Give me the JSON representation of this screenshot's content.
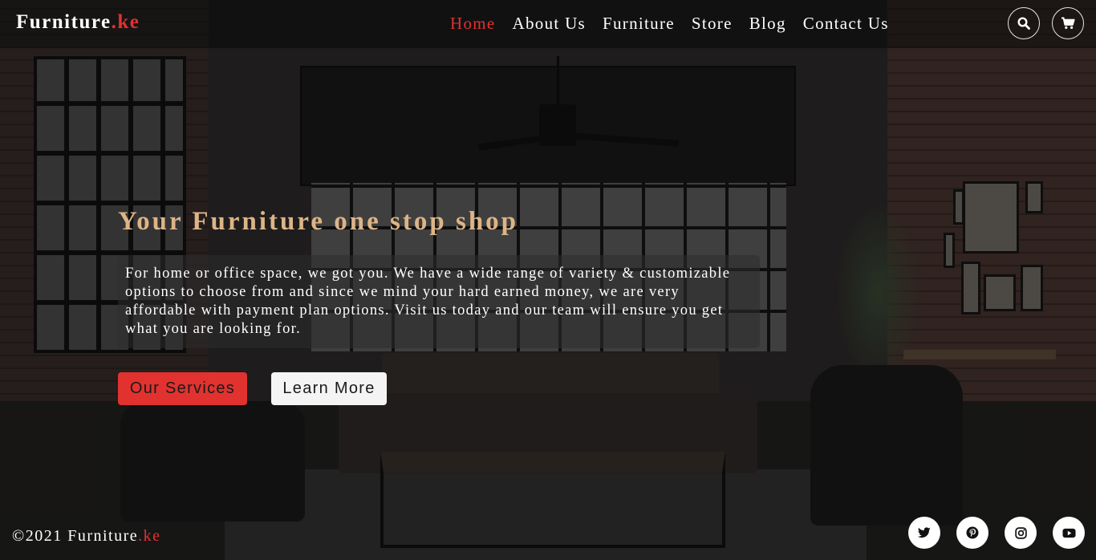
{
  "header": {
    "logo": {
      "main": "Furniture",
      "accent": ".ke"
    },
    "nav": [
      {
        "label": "Home",
        "active": true
      },
      {
        "label": "About Us",
        "active": false
      },
      {
        "label": "Furniture",
        "active": false
      },
      {
        "label": "Store",
        "active": false
      },
      {
        "label": "Blog",
        "active": false
      },
      {
        "label": "Contact Us",
        "active": false
      }
    ],
    "icons": [
      "search-icon",
      "cart-icon"
    ]
  },
  "hero": {
    "title": "Your Furniture one stop shop",
    "description": "For home or office space, we got you. We have a wide range of variety & customizable options to choose from and since we mind your hard earned money, we are very affordable with payment plan options. Visit us today and our team will ensure you get what you are looking for.",
    "primary_button": "Our Services",
    "secondary_button": "Learn More"
  },
  "footer": {
    "copyright": "©2021 Furniture",
    "copyright_accent": ".ke",
    "social": [
      "twitter-icon",
      "pinterest-icon",
      "instagram-icon",
      "youtube-icon"
    ]
  },
  "colors": {
    "accent": "#e2322f",
    "title": "#ddb487",
    "button_light": "#f4f4f4"
  }
}
